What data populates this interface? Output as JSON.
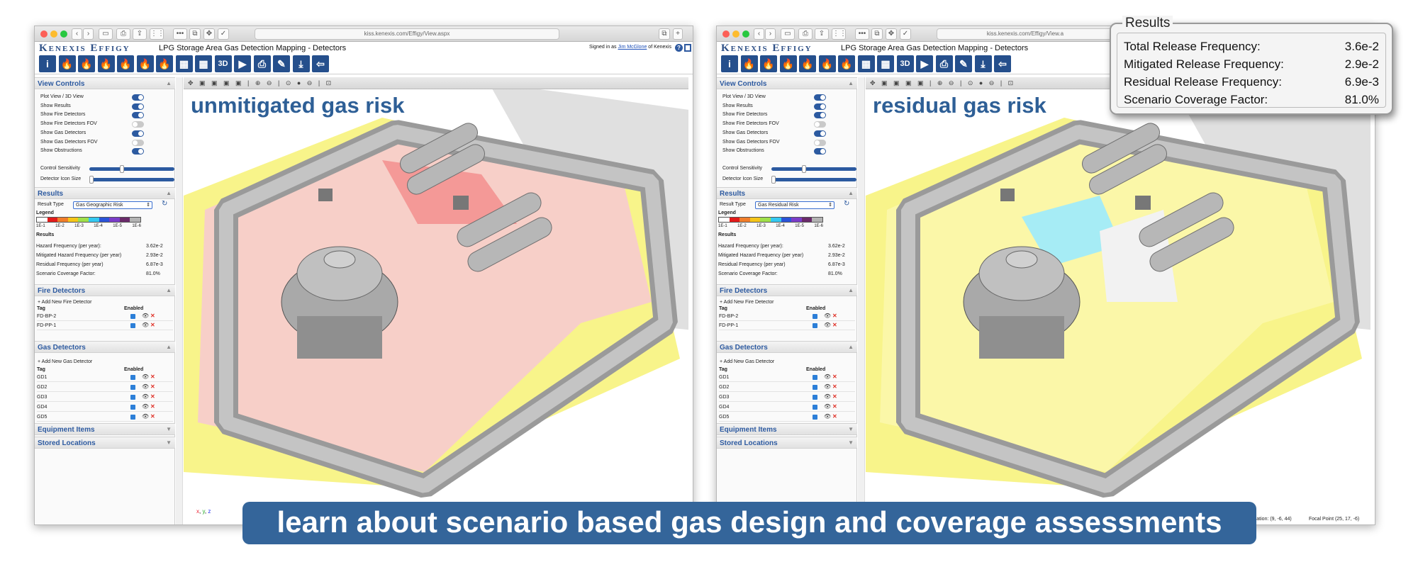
{
  "browser": {
    "url": "kiss.kenexis.com/Effigy/View.aspx",
    "url_right": "kiss.kenexis.com/Effigy/View.a",
    "tab_badge": "2"
  },
  "app": {
    "logo": "Kenexis Effigy",
    "title": "LPG Storage Area Gas Detection Mapping - Detectors",
    "signed_in_prefix": "Signed in as ",
    "user": "Jim McGlone",
    "signed_in_suffix": " of Kenexis",
    "help": "?"
  },
  "toolbar": {
    "buttons": [
      "info",
      "fire",
      "fire",
      "fire",
      "fire",
      "fire",
      "fire",
      "building",
      "building",
      "3D",
      "play",
      "print",
      "wrench",
      "download",
      "back"
    ],
    "label_3d": "3D"
  },
  "view_controls": {
    "title": "View Controls",
    "items": [
      {
        "label": "Plot View / 3D View",
        "on": true
      },
      {
        "label": "Show Results",
        "on": true
      },
      {
        "label": "Show Fire Detectors",
        "on": true
      },
      {
        "label": "Show Fire Detectors FOV",
        "on": false
      },
      {
        "label": "Show Gas Detectors",
        "on": true
      },
      {
        "label": "Show Gas Detectors FOV",
        "on": false
      },
      {
        "label": "Show Obstructions",
        "on": true
      }
    ],
    "control_sensitivity": "Control Sensitivity",
    "control_sensitivity_value": 0.38,
    "detector_icon_size": "Detector Icon Size",
    "detector_icon_size_value": 0.0
  },
  "results": {
    "title": "Results",
    "result_type_label": "Result Type",
    "legend_label": "Legend",
    "results_label": "Results",
    "legend_colors": [
      "#ffffff",
      "#e21a1a",
      "#f07d2a",
      "#f5c518",
      "#9fe04a",
      "#34c8f0",
      "#2a53d8",
      "#7a3cc8",
      "#6a2a6a",
      "#b3b3b3"
    ],
    "legend_ticks": [
      "1E-1",
      "1E-2",
      "1E-3",
      "1E-4",
      "1E-5",
      "1E-6"
    ],
    "rows": [
      {
        "k": "Hazard Frequency (per year):",
        "v": "3.62e-2"
      },
      {
        "k": "Mitigated Hazard Frequency (per year)",
        "v": "2.93e-2"
      },
      {
        "k": "Residual Frequency (per year)",
        "v": "6.87e-3"
      },
      {
        "k": "Scenario Coverage Factor:",
        "v": "81.0%"
      }
    ]
  },
  "fire_detectors": {
    "title": "Fire Detectors",
    "add": "+ Add New Fire Detector",
    "col_tag": "Tag",
    "col_enabled": "Enabled",
    "rows": [
      {
        "tag": "FD-BP-2"
      },
      {
        "tag": "FD-PP-1"
      }
    ]
  },
  "gas_detectors": {
    "title": "Gas Detectors",
    "add": "+ Add New Gas Detector",
    "col_tag": "Tag",
    "col_enabled": "Enabled",
    "rows": [
      {
        "tag": "GD1"
      },
      {
        "tag": "GD2"
      },
      {
        "tag": "GD3"
      },
      {
        "tag": "GD4"
      },
      {
        "tag": "GD5"
      }
    ]
  },
  "sections_collapsed": {
    "equipment": "Equipment Items",
    "stored": "Stored Locations"
  },
  "left": {
    "overlay_label": "unmitigated gas risk",
    "result_type": "Gas Geographic Risk"
  },
  "right": {
    "overlay_label": "residual gas risk",
    "result_type": "Gas Residual Risk",
    "status_location": "Location: (9, -6, 44)",
    "status_focal": "Focal Point (25, 17, -6)"
  },
  "viewport_tools": "✥ ▣ ▣ ▣ ▣ | ⊕ ⊖ | ⊙ ● ⊖ | ⊡",
  "axes": {
    "x": "x",
    "y": "y",
    "z": "z"
  },
  "callout": {
    "title": "Results",
    "rows": [
      {
        "k": "Total Release Frequency:",
        "v": "3.6e-2"
      },
      {
        "k": "Mitigated Release Frequency:",
        "v": "2.9e-2"
      },
      {
        "k": "Residual Release Frequency:",
        "v": "6.9e-3"
      },
      {
        "k": "Scenario Coverage Factor:",
        "v": "81.0%"
      }
    ]
  },
  "banner": "learn about scenario based gas design and coverage assessments",
  "colors": {
    "accent": "#2d5aa0",
    "banner": "#34659a",
    "risk_pink": "#f7cfc8",
    "risk_yellow": "#f8f48a",
    "risk_cyan": "#a6ecf5"
  }
}
